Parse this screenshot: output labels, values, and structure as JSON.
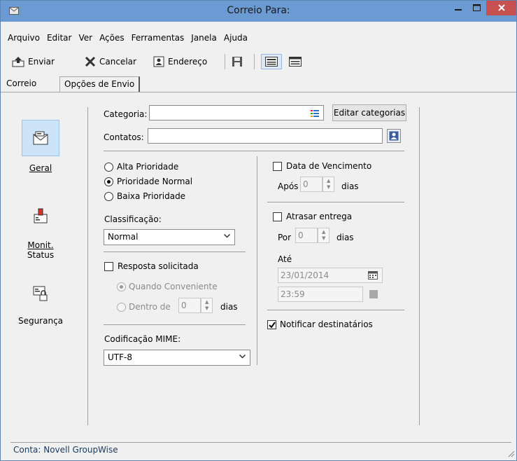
{
  "window": {
    "title": "Correio Para:"
  },
  "menu": [
    "Arquivo",
    "Editar",
    "Ver",
    "Ações",
    "Ferramentas",
    "Janela",
    "Ajuda"
  ],
  "toolbar": {
    "send": "Enviar",
    "cancel": "Cancelar",
    "address": "Endereço"
  },
  "tabs": [
    "Correio",
    "Opções de Envio"
  ],
  "sidebar": {
    "general": "Geral",
    "status_line1": "Monit.",
    "status_line2": "Status",
    "security": "Segurança"
  },
  "form": {
    "category_label": "Categoria:",
    "category_value": "",
    "edit_categories": "Editar categorias",
    "contacts_label": "Contatos:",
    "contacts_value": "",
    "priority_high": "Alta Prioridade",
    "priority_normal": "Prioridade Normal",
    "priority_low": "Baixa Prioridade",
    "classification_label": "Classificação:",
    "classification_value": "Normal",
    "reply_requested": "Resposta solicitada",
    "when_convenient": "Quando Conveniente",
    "within": "Dentro de",
    "within_value": "0",
    "within_unit": "dias",
    "mime_label": "Codificação MIME:",
    "mime_value": "UTF-8",
    "due_date": "Data de Vencimento",
    "after_label": "Após",
    "after_value": "0",
    "after_unit": "dias",
    "delay_delivery": "Atrasar entrega",
    "by_label": "Por",
    "by_value": "0",
    "by_unit": "dias",
    "until_label": "Até",
    "until_date": "23/01/2014",
    "until_time": "23:59",
    "notify_recipients": "Notificar destinatários"
  },
  "state": {
    "priority": "normal",
    "reply_requested": false,
    "reply_option": "when_convenient",
    "due_date": false,
    "delay_delivery": false,
    "notify_recipients": true
  },
  "status": {
    "account": "Conta: Novell GroupWise"
  },
  "colors": {
    "titlebar": "#6b9bd2",
    "close": "#c75050",
    "selected": "#cde3f7"
  }
}
